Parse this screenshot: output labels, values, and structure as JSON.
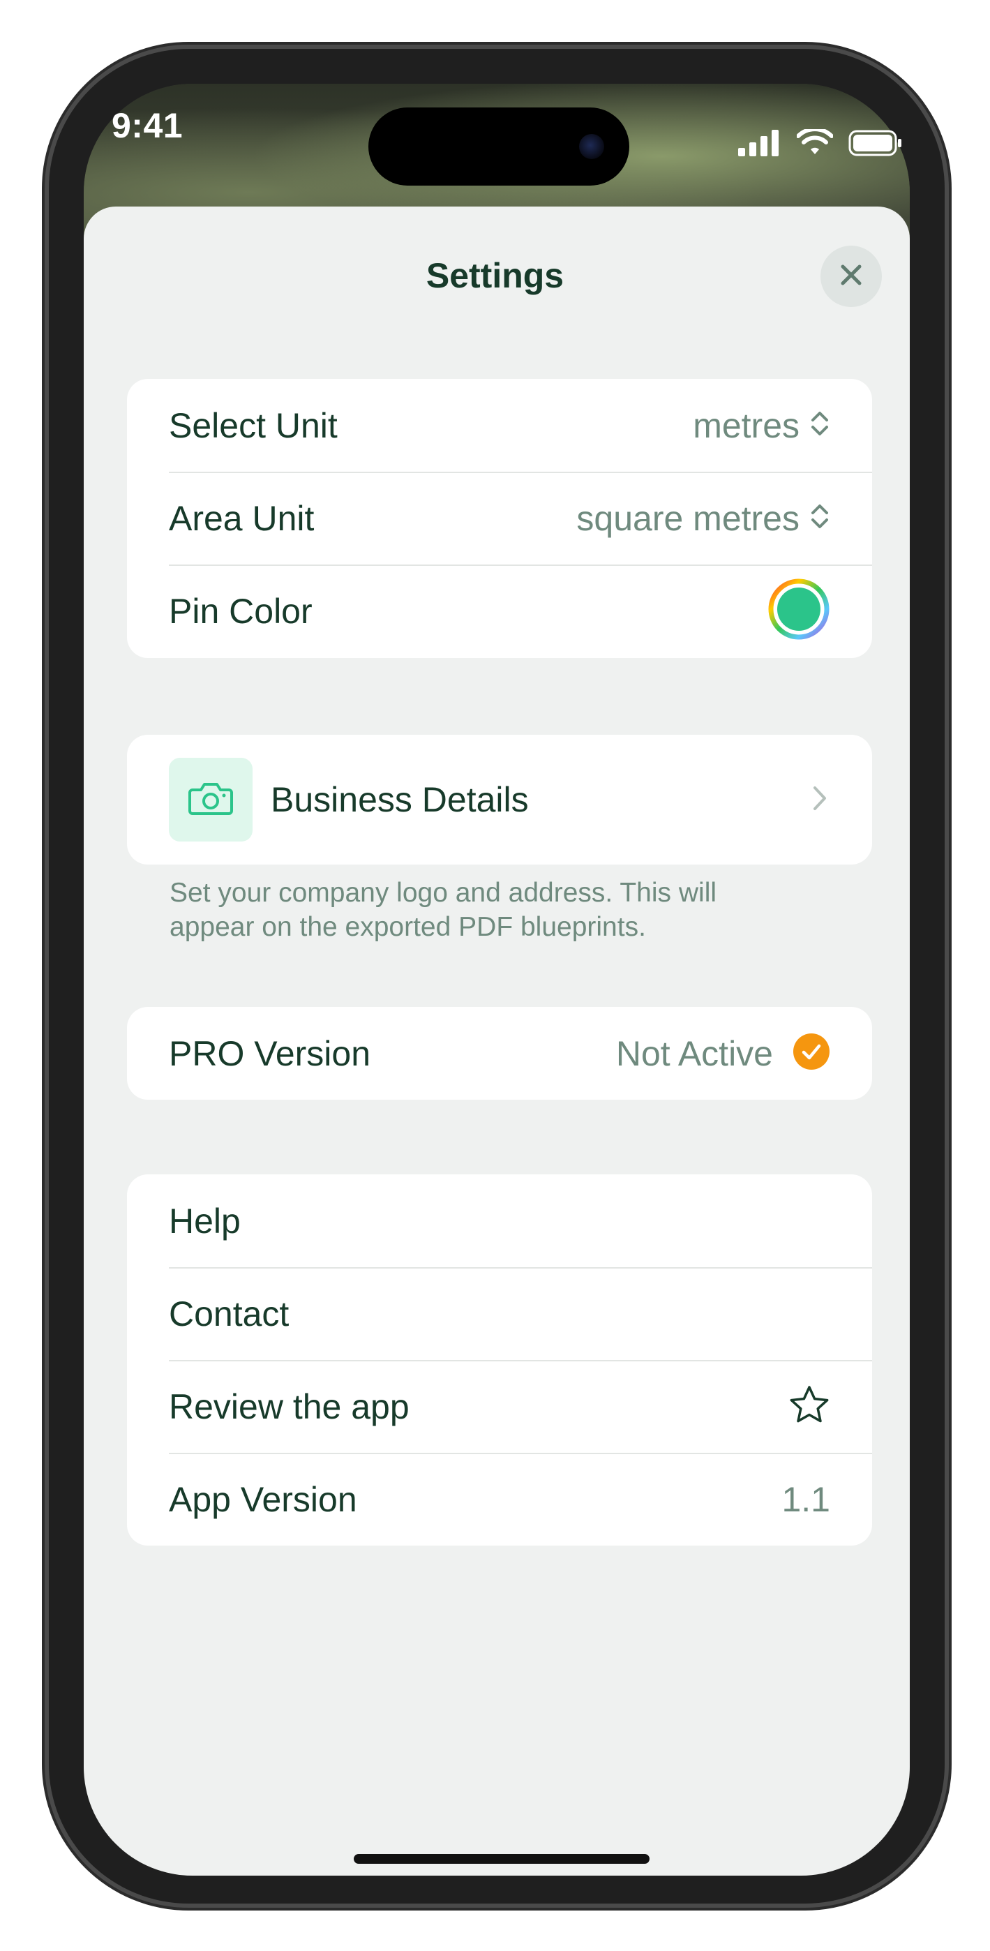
{
  "status_bar": {
    "time": "9:41"
  },
  "header": {
    "title": "Settings",
    "close_icon": "close-icon"
  },
  "units_section": {
    "select_unit": {
      "label": "Select Unit",
      "value": "metres",
      "icon": "chevron-updown-icon"
    },
    "area_unit": {
      "label": "Area Unit",
      "value": "square metres",
      "icon": "chevron-updown-icon"
    },
    "pin_color": {
      "label": "Pin Color",
      "color": "#2bc48a"
    }
  },
  "business_section": {
    "label": "Business Details",
    "icon": "camera-icon",
    "footnote": "Set your company logo and address. This will appear on the exported PDF blueprints."
  },
  "pro_section": {
    "label": "PRO Version",
    "value": "Not Active",
    "badge_color": "#f5960f"
  },
  "info_section": {
    "help": {
      "label": "Help"
    },
    "contact": {
      "label": "Contact"
    },
    "review": {
      "label": "Review the app",
      "icon": "star-icon"
    },
    "version": {
      "label": "App Version",
      "value": "1.1"
    }
  },
  "colors": {
    "accent": "#173a2a",
    "secondary": "#6f8a7e",
    "background": "#eff1f0",
    "icon_tile": "#dff7ec"
  }
}
